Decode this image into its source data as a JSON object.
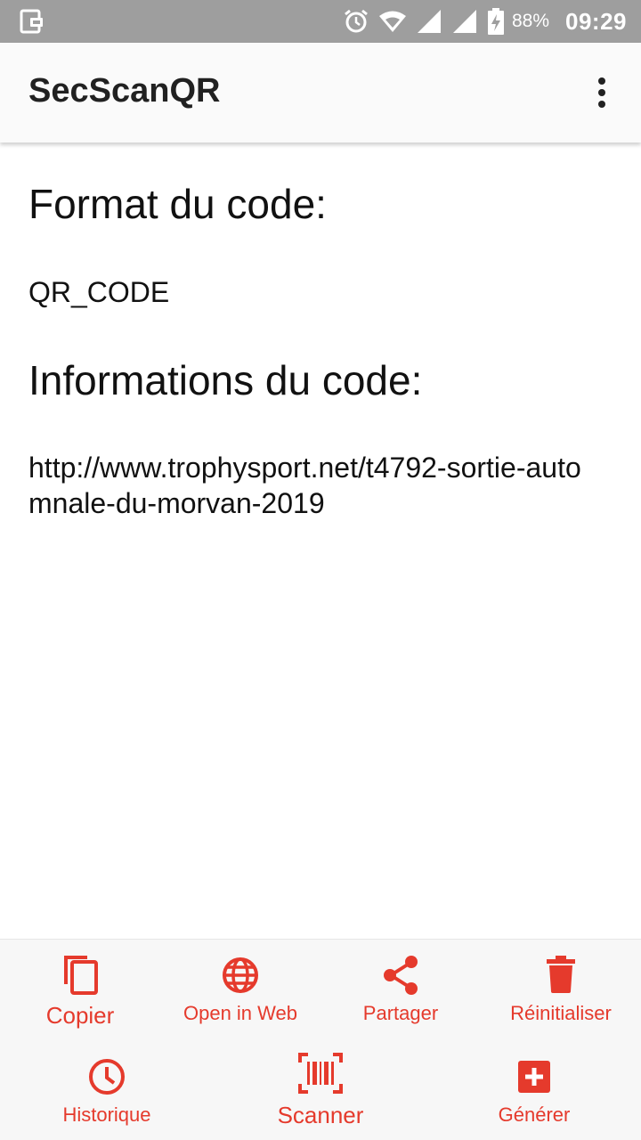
{
  "status_bar": {
    "battery": "88%",
    "time": "09:29",
    "icons": [
      "screenshot-icon",
      "alarm-icon",
      "wifi-icon",
      "signal-icon",
      "signal-icon",
      "battery-charging-icon"
    ]
  },
  "app_bar": {
    "title": "SecScanQR",
    "menu_icon": "more-vert-icon"
  },
  "content": {
    "format_heading": "Format du code:",
    "format_value": "QR_CODE",
    "info_heading": "Informations du code:",
    "info_value": "http://www.trophysport.net/t4792-sortie-automnale-du-morvan-2019"
  },
  "actions": {
    "copy": "Copier",
    "open_web": "Open in Web",
    "share": "Partager",
    "reset": "Réinitialiser",
    "history": "Historique",
    "scan": "Scanner",
    "generate": "Générer"
  },
  "colors": {
    "accent": "#e53a2c",
    "status_bar": "#9e9e9e",
    "app_bar": "#fafafa",
    "bottom_bar": "#f7f7f7"
  }
}
